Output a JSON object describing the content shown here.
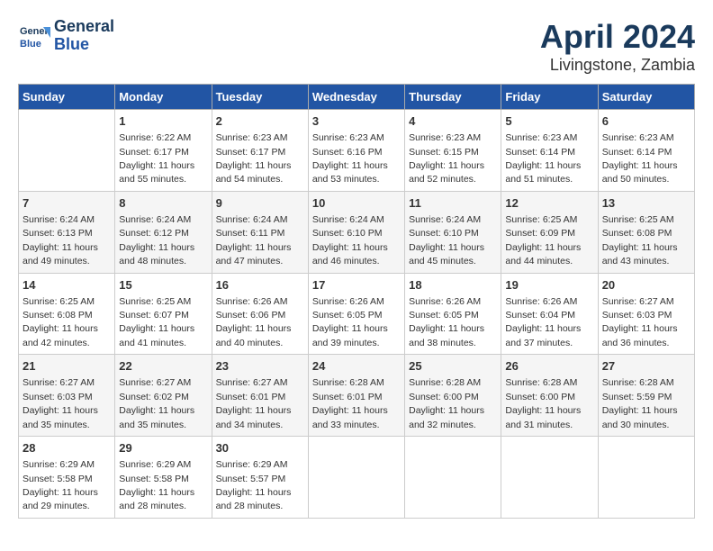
{
  "header": {
    "logo_line1": "General",
    "logo_line2": "Blue",
    "title": "April 2024",
    "subtitle": "Livingstone, Zambia"
  },
  "days_of_week": [
    "Sunday",
    "Monday",
    "Tuesday",
    "Wednesday",
    "Thursday",
    "Friday",
    "Saturday"
  ],
  "weeks": [
    [
      {
        "day": "",
        "detail": ""
      },
      {
        "day": "1",
        "detail": "Sunrise: 6:22 AM\nSunset: 6:17 PM\nDaylight: 11 hours\nand 55 minutes."
      },
      {
        "day": "2",
        "detail": "Sunrise: 6:23 AM\nSunset: 6:17 PM\nDaylight: 11 hours\nand 54 minutes."
      },
      {
        "day": "3",
        "detail": "Sunrise: 6:23 AM\nSunset: 6:16 PM\nDaylight: 11 hours\nand 53 minutes."
      },
      {
        "day": "4",
        "detail": "Sunrise: 6:23 AM\nSunset: 6:15 PM\nDaylight: 11 hours\nand 52 minutes."
      },
      {
        "day": "5",
        "detail": "Sunrise: 6:23 AM\nSunset: 6:14 PM\nDaylight: 11 hours\nand 51 minutes."
      },
      {
        "day": "6",
        "detail": "Sunrise: 6:23 AM\nSunset: 6:14 PM\nDaylight: 11 hours\nand 50 minutes."
      }
    ],
    [
      {
        "day": "7",
        "detail": "Sunrise: 6:24 AM\nSunset: 6:13 PM\nDaylight: 11 hours\nand 49 minutes."
      },
      {
        "day": "8",
        "detail": "Sunrise: 6:24 AM\nSunset: 6:12 PM\nDaylight: 11 hours\nand 48 minutes."
      },
      {
        "day": "9",
        "detail": "Sunrise: 6:24 AM\nSunset: 6:11 PM\nDaylight: 11 hours\nand 47 minutes."
      },
      {
        "day": "10",
        "detail": "Sunrise: 6:24 AM\nSunset: 6:10 PM\nDaylight: 11 hours\nand 46 minutes."
      },
      {
        "day": "11",
        "detail": "Sunrise: 6:24 AM\nSunset: 6:10 PM\nDaylight: 11 hours\nand 45 minutes."
      },
      {
        "day": "12",
        "detail": "Sunrise: 6:25 AM\nSunset: 6:09 PM\nDaylight: 11 hours\nand 44 minutes."
      },
      {
        "day": "13",
        "detail": "Sunrise: 6:25 AM\nSunset: 6:08 PM\nDaylight: 11 hours\nand 43 minutes."
      }
    ],
    [
      {
        "day": "14",
        "detail": "Sunrise: 6:25 AM\nSunset: 6:08 PM\nDaylight: 11 hours\nand 42 minutes."
      },
      {
        "day": "15",
        "detail": "Sunrise: 6:25 AM\nSunset: 6:07 PM\nDaylight: 11 hours\nand 41 minutes."
      },
      {
        "day": "16",
        "detail": "Sunrise: 6:26 AM\nSunset: 6:06 PM\nDaylight: 11 hours\nand 40 minutes."
      },
      {
        "day": "17",
        "detail": "Sunrise: 6:26 AM\nSunset: 6:05 PM\nDaylight: 11 hours\nand 39 minutes."
      },
      {
        "day": "18",
        "detail": "Sunrise: 6:26 AM\nSunset: 6:05 PM\nDaylight: 11 hours\nand 38 minutes."
      },
      {
        "day": "19",
        "detail": "Sunrise: 6:26 AM\nSunset: 6:04 PM\nDaylight: 11 hours\nand 37 minutes."
      },
      {
        "day": "20",
        "detail": "Sunrise: 6:27 AM\nSunset: 6:03 PM\nDaylight: 11 hours\nand 36 minutes."
      }
    ],
    [
      {
        "day": "21",
        "detail": "Sunrise: 6:27 AM\nSunset: 6:03 PM\nDaylight: 11 hours\nand 35 minutes."
      },
      {
        "day": "22",
        "detail": "Sunrise: 6:27 AM\nSunset: 6:02 PM\nDaylight: 11 hours\nand 35 minutes."
      },
      {
        "day": "23",
        "detail": "Sunrise: 6:27 AM\nSunset: 6:01 PM\nDaylight: 11 hours\nand 34 minutes."
      },
      {
        "day": "24",
        "detail": "Sunrise: 6:28 AM\nSunset: 6:01 PM\nDaylight: 11 hours\nand 33 minutes."
      },
      {
        "day": "25",
        "detail": "Sunrise: 6:28 AM\nSunset: 6:00 PM\nDaylight: 11 hours\nand 32 minutes."
      },
      {
        "day": "26",
        "detail": "Sunrise: 6:28 AM\nSunset: 6:00 PM\nDaylight: 11 hours\nand 31 minutes."
      },
      {
        "day": "27",
        "detail": "Sunrise: 6:28 AM\nSunset: 5:59 PM\nDaylight: 11 hours\nand 30 minutes."
      }
    ],
    [
      {
        "day": "28",
        "detail": "Sunrise: 6:29 AM\nSunset: 5:58 PM\nDaylight: 11 hours\nand 29 minutes."
      },
      {
        "day": "29",
        "detail": "Sunrise: 6:29 AM\nSunset: 5:58 PM\nDaylight: 11 hours\nand 28 minutes."
      },
      {
        "day": "30",
        "detail": "Sunrise: 6:29 AM\nSunset: 5:57 PM\nDaylight: 11 hours\nand 28 minutes."
      },
      {
        "day": "",
        "detail": ""
      },
      {
        "day": "",
        "detail": ""
      },
      {
        "day": "",
        "detail": ""
      },
      {
        "day": "",
        "detail": ""
      }
    ]
  ]
}
